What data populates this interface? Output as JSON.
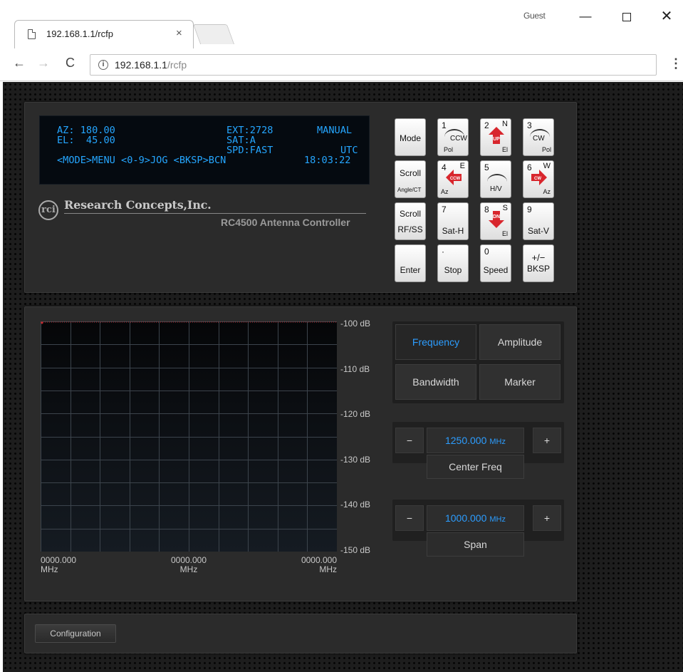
{
  "browser": {
    "tab_title": "192.168.1.1/rcfp",
    "tab_close": "×",
    "profile": "Guest",
    "window_min": "—",
    "window_close": "✕",
    "back": "←",
    "forward": "→",
    "reload": "C",
    "url_host": "192.168.1.1",
    "url_path": "/rcfp",
    "menu": "⋮"
  },
  "lcd": {
    "line1_left": "AZ: 180.00",
    "line1_mid": "EXT:2728",
    "line1_right": "MANUAL",
    "line2_left": "EL:  45.00",
    "line2_mid": "SAT:A",
    "line3_mid": "SPD:FAST",
    "line3_right": "UTC",
    "line4_left": "<MODE>MENU <0-9>JOG <BKSP>BCN",
    "line4_right": "18:03:22"
  },
  "brand": {
    "logo_mark": "rci",
    "company": "Research Concepts,Inc.",
    "product": "RC4500 Antenna Controller"
  },
  "keypad": {
    "mode": "Mode",
    "k1_num": "1",
    "k1_label": "CCW",
    "k1_sub": "Pol",
    "k2_num": "2",
    "k2_dir": "N",
    "k2_arrow": "UP",
    "k2_sub": "El",
    "k3_num": "3",
    "k3_label": "CW",
    "k3_sub": "Pol",
    "scroll_up": "Scroll",
    "scroll_up_sub": "Angle/CT",
    "k4_num": "4",
    "k4_dir": "E",
    "k4_arrow": "CCW",
    "k4_sub": "Az",
    "k5_num": "5",
    "k5_label": "H/V",
    "k6_num": "6",
    "k6_dir": "W",
    "k6_arrow": "CW",
    "k6_sub": "Az",
    "scroll_down": "Scroll",
    "scroll_down_sub": "RF/SS",
    "k7_num": "7",
    "k7_label": "Sat-H",
    "k8_num": "8",
    "k8_dir": "S",
    "k8_arrow": "DN",
    "k8_sub": "El",
    "k9_num": "9",
    "k9_label": "Sat-V",
    "enter": "Enter",
    "stop_num": "·",
    "stop": "Stop",
    "speed_num": "0",
    "speed": "Speed",
    "bksp_top": "+/−",
    "bksp": "BKSP"
  },
  "chart_data": {
    "type": "line",
    "ylim": [
      -150,
      -100
    ],
    "y_ticks": [
      "-100 dB",
      "-110 dB",
      "-120 dB",
      "-130 dB",
      "-140 dB",
      "-150 dB"
    ],
    "x_ticks": [
      {
        "value": "0000.000",
        "unit": "MHz"
      },
      {
        "value": "0000.000",
        "unit": "MHz"
      },
      {
        "value": "0000.000",
        "unit": "MHz"
      }
    ],
    "grid": true,
    "series": [
      {
        "color": "#c8282e",
        "values": [
          -100,
          -100
        ]
      }
    ]
  },
  "analyzer": {
    "tabs": [
      "Frequency",
      "Amplitude",
      "Bandwidth",
      "Marker"
    ],
    "active_tab": "Frequency",
    "center": {
      "minus": "−",
      "value": "1250.000",
      "unit": "MHz",
      "plus": "+",
      "label": "Center Freq"
    },
    "span": {
      "minus": "−",
      "value": "1000.000",
      "unit": "MHz",
      "plus": "+",
      "label": "Span"
    }
  },
  "footer": {
    "config_button": "Configuration"
  },
  "colors": {
    "lcd_text": "#25a6ff",
    "accent": "#2c9dff",
    "arrow_red": "#d8262d"
  }
}
